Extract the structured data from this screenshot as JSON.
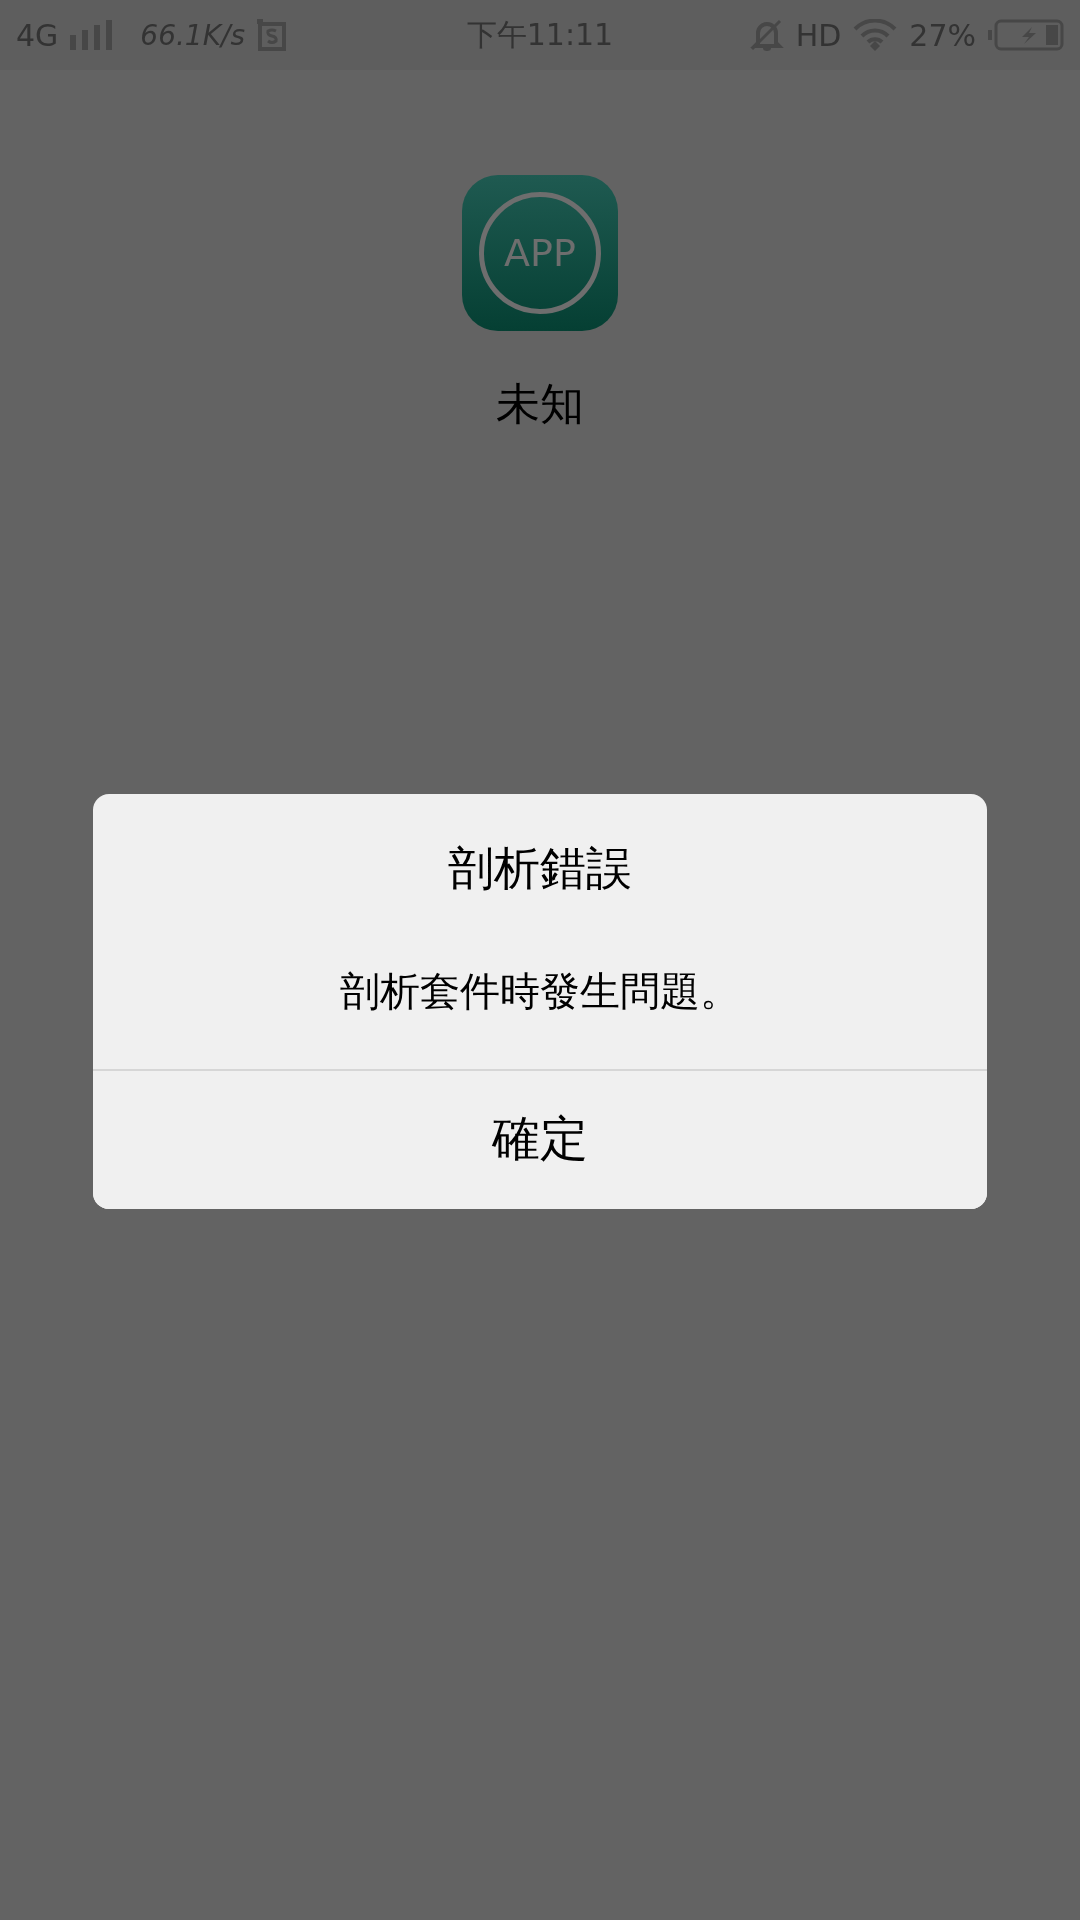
{
  "status_bar": {
    "network": "4G",
    "speed": "66.1K/s",
    "time": "下午11:11",
    "hd": "HD",
    "battery": "27%"
  },
  "app": {
    "icon_label": "APP",
    "name": "未知"
  },
  "dialog": {
    "title": "剖析錯誤",
    "message": "剖析套件時發生問題。",
    "buttons": [
      "確定"
    ]
  }
}
